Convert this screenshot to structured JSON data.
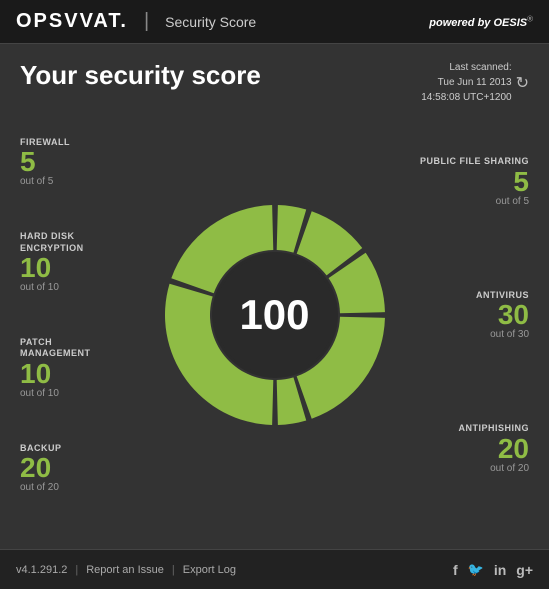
{
  "header": {
    "logo": "OPSVVAT.",
    "divider": "|",
    "title": "Security Score",
    "powered_by_prefix": "powered by",
    "powered_by_brand": "OESIS",
    "powered_by_sup": "®"
  },
  "main": {
    "page_title": "Your security score",
    "last_scanned_label": "Last scanned:",
    "last_scanned_date": "Tue Jun 11 2013",
    "last_scanned_time": "14:58:08 UTC+1200",
    "score_value": "100",
    "items_left": [
      {
        "label": "FIREWALL",
        "value": "5",
        "outof": "out of 5"
      },
      {
        "label": "HARD DISK\nENCRYPTION",
        "value": "10",
        "outof": "out of 10"
      },
      {
        "label": "PATCH\nMANAGEMENT",
        "value": "10",
        "outof": "out of 10"
      },
      {
        "label": "BACKUP",
        "value": "20",
        "outof": "out of 20"
      }
    ],
    "items_right": [
      {
        "label": "PUBLIC FILE SHARING",
        "value": "5",
        "outof": "out of 5"
      },
      {
        "label": "ANTIVIRUS",
        "value": "30",
        "outof": "out of 30"
      },
      {
        "label": "ANTIPHISHING",
        "value": "20",
        "outof": "out of 20"
      }
    ]
  },
  "footer": {
    "version": "v4.1.291.2",
    "separator1": "|",
    "report_issue": "Report an Issue",
    "separator2": "|",
    "export_log": "Export Log",
    "social": [
      "f",
      "✦",
      "in",
      "g+"
    ]
  },
  "colors": {
    "green": "#8fbc45",
    "dark_bg": "#2a2a2a",
    "header_bg": "#1a1a1a",
    "main_bg": "#333333"
  }
}
